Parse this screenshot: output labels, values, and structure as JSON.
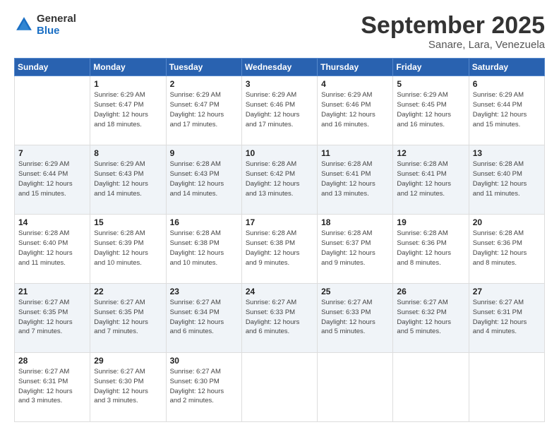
{
  "header": {
    "logo_line1": "General",
    "logo_line2": "Blue",
    "month": "September 2025",
    "location": "Sanare, Lara, Venezuela"
  },
  "weekdays": [
    "Sunday",
    "Monday",
    "Tuesday",
    "Wednesday",
    "Thursday",
    "Friday",
    "Saturday"
  ],
  "weeks": [
    [
      {
        "day": "",
        "info": ""
      },
      {
        "day": "1",
        "info": "Sunrise: 6:29 AM\nSunset: 6:47 PM\nDaylight: 12 hours\nand 18 minutes."
      },
      {
        "day": "2",
        "info": "Sunrise: 6:29 AM\nSunset: 6:47 PM\nDaylight: 12 hours\nand 17 minutes."
      },
      {
        "day": "3",
        "info": "Sunrise: 6:29 AM\nSunset: 6:46 PM\nDaylight: 12 hours\nand 17 minutes."
      },
      {
        "day": "4",
        "info": "Sunrise: 6:29 AM\nSunset: 6:46 PM\nDaylight: 12 hours\nand 16 minutes."
      },
      {
        "day": "5",
        "info": "Sunrise: 6:29 AM\nSunset: 6:45 PM\nDaylight: 12 hours\nand 16 minutes."
      },
      {
        "day": "6",
        "info": "Sunrise: 6:29 AM\nSunset: 6:44 PM\nDaylight: 12 hours\nand 15 minutes."
      }
    ],
    [
      {
        "day": "7",
        "info": "Sunrise: 6:29 AM\nSunset: 6:44 PM\nDaylight: 12 hours\nand 15 minutes."
      },
      {
        "day": "8",
        "info": "Sunrise: 6:29 AM\nSunset: 6:43 PM\nDaylight: 12 hours\nand 14 minutes."
      },
      {
        "day": "9",
        "info": "Sunrise: 6:28 AM\nSunset: 6:43 PM\nDaylight: 12 hours\nand 14 minutes."
      },
      {
        "day": "10",
        "info": "Sunrise: 6:28 AM\nSunset: 6:42 PM\nDaylight: 12 hours\nand 13 minutes."
      },
      {
        "day": "11",
        "info": "Sunrise: 6:28 AM\nSunset: 6:41 PM\nDaylight: 12 hours\nand 13 minutes."
      },
      {
        "day": "12",
        "info": "Sunrise: 6:28 AM\nSunset: 6:41 PM\nDaylight: 12 hours\nand 12 minutes."
      },
      {
        "day": "13",
        "info": "Sunrise: 6:28 AM\nSunset: 6:40 PM\nDaylight: 12 hours\nand 11 minutes."
      }
    ],
    [
      {
        "day": "14",
        "info": "Sunrise: 6:28 AM\nSunset: 6:40 PM\nDaylight: 12 hours\nand 11 minutes."
      },
      {
        "day": "15",
        "info": "Sunrise: 6:28 AM\nSunset: 6:39 PM\nDaylight: 12 hours\nand 10 minutes."
      },
      {
        "day": "16",
        "info": "Sunrise: 6:28 AM\nSunset: 6:38 PM\nDaylight: 12 hours\nand 10 minutes."
      },
      {
        "day": "17",
        "info": "Sunrise: 6:28 AM\nSunset: 6:38 PM\nDaylight: 12 hours\nand 9 minutes."
      },
      {
        "day": "18",
        "info": "Sunrise: 6:28 AM\nSunset: 6:37 PM\nDaylight: 12 hours\nand 9 minutes."
      },
      {
        "day": "19",
        "info": "Sunrise: 6:28 AM\nSunset: 6:36 PM\nDaylight: 12 hours\nand 8 minutes."
      },
      {
        "day": "20",
        "info": "Sunrise: 6:28 AM\nSunset: 6:36 PM\nDaylight: 12 hours\nand 8 minutes."
      }
    ],
    [
      {
        "day": "21",
        "info": "Sunrise: 6:27 AM\nSunset: 6:35 PM\nDaylight: 12 hours\nand 7 minutes."
      },
      {
        "day": "22",
        "info": "Sunrise: 6:27 AM\nSunset: 6:35 PM\nDaylight: 12 hours\nand 7 minutes."
      },
      {
        "day": "23",
        "info": "Sunrise: 6:27 AM\nSunset: 6:34 PM\nDaylight: 12 hours\nand 6 minutes."
      },
      {
        "day": "24",
        "info": "Sunrise: 6:27 AM\nSunset: 6:33 PM\nDaylight: 12 hours\nand 6 minutes."
      },
      {
        "day": "25",
        "info": "Sunrise: 6:27 AM\nSunset: 6:33 PM\nDaylight: 12 hours\nand 5 minutes."
      },
      {
        "day": "26",
        "info": "Sunrise: 6:27 AM\nSunset: 6:32 PM\nDaylight: 12 hours\nand 5 minutes."
      },
      {
        "day": "27",
        "info": "Sunrise: 6:27 AM\nSunset: 6:31 PM\nDaylight: 12 hours\nand 4 minutes."
      }
    ],
    [
      {
        "day": "28",
        "info": "Sunrise: 6:27 AM\nSunset: 6:31 PM\nDaylight: 12 hours\nand 3 minutes."
      },
      {
        "day": "29",
        "info": "Sunrise: 6:27 AM\nSunset: 6:30 PM\nDaylight: 12 hours\nand 3 minutes."
      },
      {
        "day": "30",
        "info": "Sunrise: 6:27 AM\nSunset: 6:30 PM\nDaylight: 12 hours\nand 2 minutes."
      },
      {
        "day": "",
        "info": ""
      },
      {
        "day": "",
        "info": ""
      },
      {
        "day": "",
        "info": ""
      },
      {
        "day": "",
        "info": ""
      }
    ]
  ]
}
